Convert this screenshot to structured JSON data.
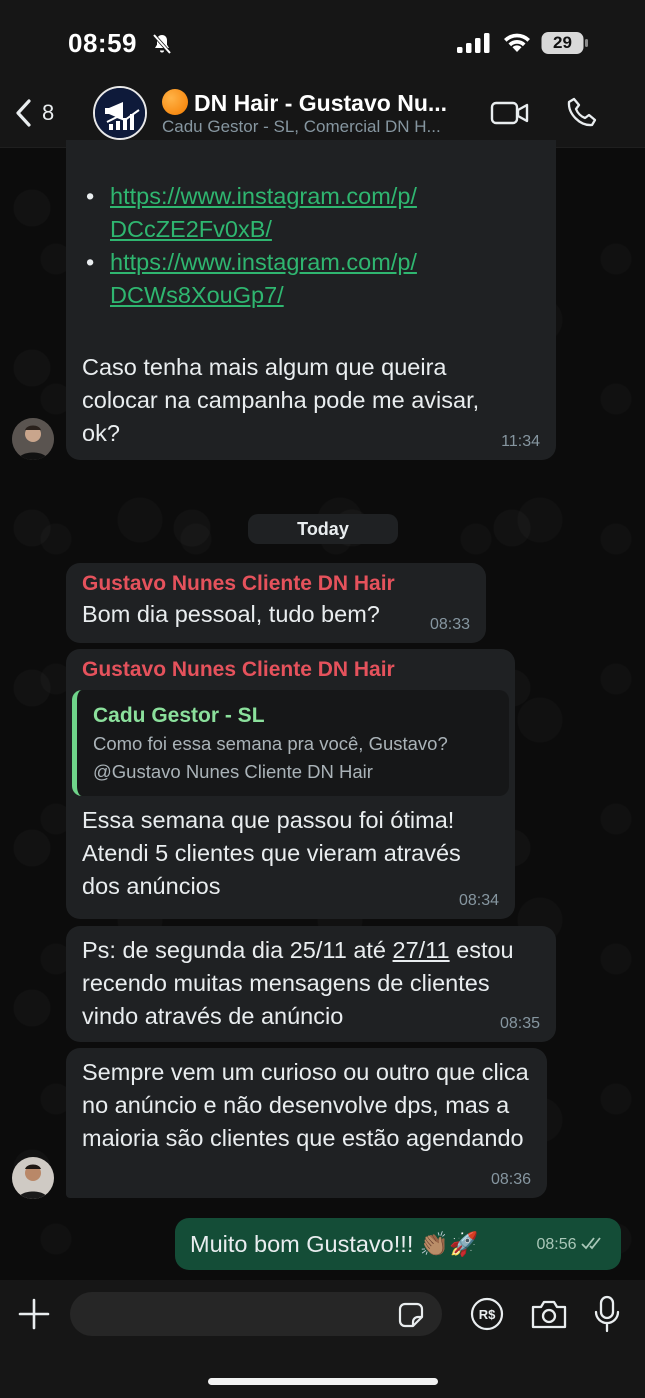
{
  "status_bar": {
    "time": "08:59",
    "battery_level": "29"
  },
  "header": {
    "back_count": "8",
    "title": "DN Hair - Gustavo Nu...",
    "subtitle": "Cadu Gestor - SL, Comercial DN H..."
  },
  "messages": {
    "m1": {
      "links": [
        "https://www.instagram.com/p/DCcZE2Fv0xB/",
        "https://www.instagram.com/p/DCWs8XouGp7/"
      ],
      "link1_line1": "https://www.instagram.com/p/",
      "link1_line2": "DCcZE2Fv0xB/",
      "link2_line1": "https://www.instagram.com/p/",
      "link2_line2": "DCWs8XouGp7/",
      "text": "Caso tenha mais algum que queira colocar na campanha pode me avisar, ok?",
      "time": "11:34"
    },
    "date_divider": "Today",
    "m2": {
      "sender": "Gustavo Nunes Cliente DN Hair",
      "text": "Bom dia pessoal, tudo bem?",
      "time": "08:33"
    },
    "m3": {
      "sender": "Gustavo Nunes Cliente DN Hair",
      "quote_sender": "Cadu Gestor - SL",
      "quote_text_line1": "Como foi essa semana pra você, Gustavo?",
      "quote_text_line2": "@Gustavo Nunes Cliente DN Hair",
      "text": "Essa semana que passou foi ótima! Atendi 5 clientes que vieram através dos anúncios",
      "time": "08:34"
    },
    "m4": {
      "text_before": "Ps: de segunda dia 25/11 até ",
      "text_underlined": "27/11",
      "text_after": " estou recendo muitas mensagens de clientes vindo através de anúncio",
      "time": "08:35"
    },
    "m5": {
      "text": "Sempre vem um curioso ou outro que clica no anúncio e não desenvolve dps, mas a maioria são clientes que estão agendando",
      "time": "08:36"
    },
    "m6_outgoing": {
      "text": "Muito bom Gustavo!!! 👏🏽🚀",
      "time": "08:56",
      "status": "read"
    }
  },
  "composer": {
    "placeholder": ""
  },
  "colors": {
    "sender_name": "#e5525c",
    "link": "#2fb670",
    "outgoing_bubble": "#144d37",
    "quote_bar": "#6fd48a"
  }
}
